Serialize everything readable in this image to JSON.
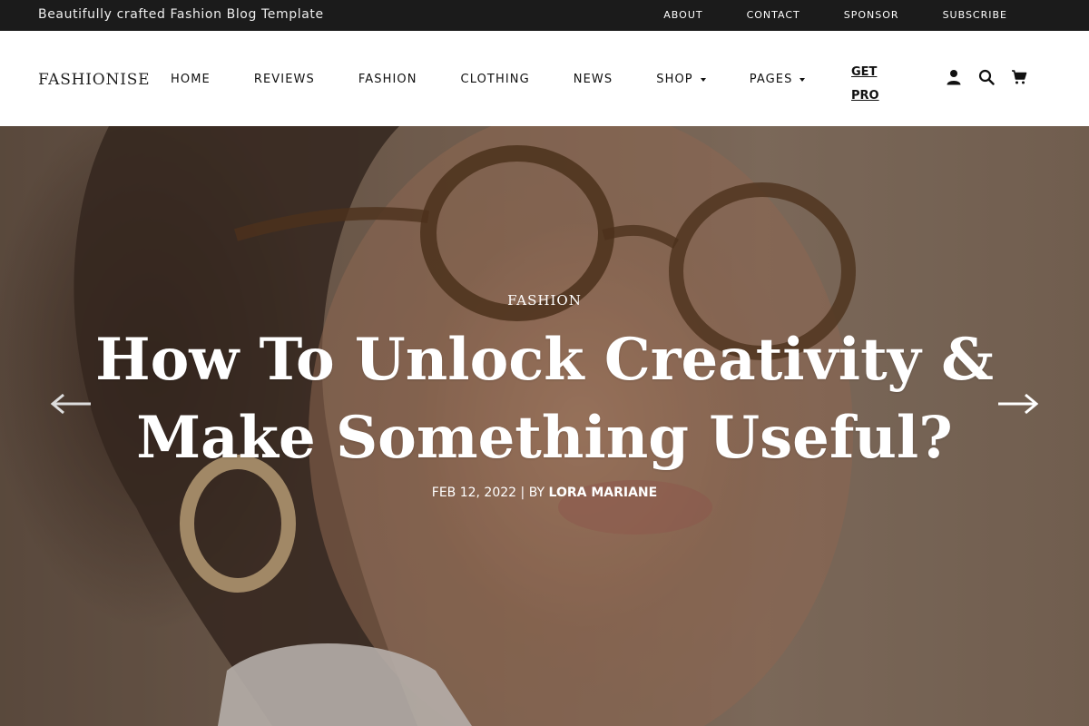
{
  "topbar": {
    "tagline": "Beautifully crafted Fashion Blog Template",
    "links": [
      "ABOUT",
      "CONTACT",
      "SPONSOR",
      "SUBSCRIBE"
    ]
  },
  "header": {
    "logo": "FASHIONISE",
    "nav": [
      "HOME",
      "REVIEWS",
      "FASHION",
      "CLOTHING",
      "NEWS",
      "SHOP",
      "PAGES"
    ],
    "get_pro_line1": "GET",
    "get_pro_line2": "PRO",
    "icons": [
      "user-icon",
      "search-icon",
      "cart-icon"
    ]
  },
  "hero": {
    "category": "FASHION",
    "title": "How To Unlock Creativity & Make Something Useful?",
    "date": "FEB 12, 2022",
    "separator": "|",
    "by": "BY",
    "author": "LORA MARIANE",
    "prev_icon": "arrow-left-icon",
    "next_icon": "arrow-right-icon"
  },
  "colors": {
    "topbar_bg": "#1b1b1b",
    "text_dark": "#111111",
    "hero_text": "#ffffff"
  }
}
